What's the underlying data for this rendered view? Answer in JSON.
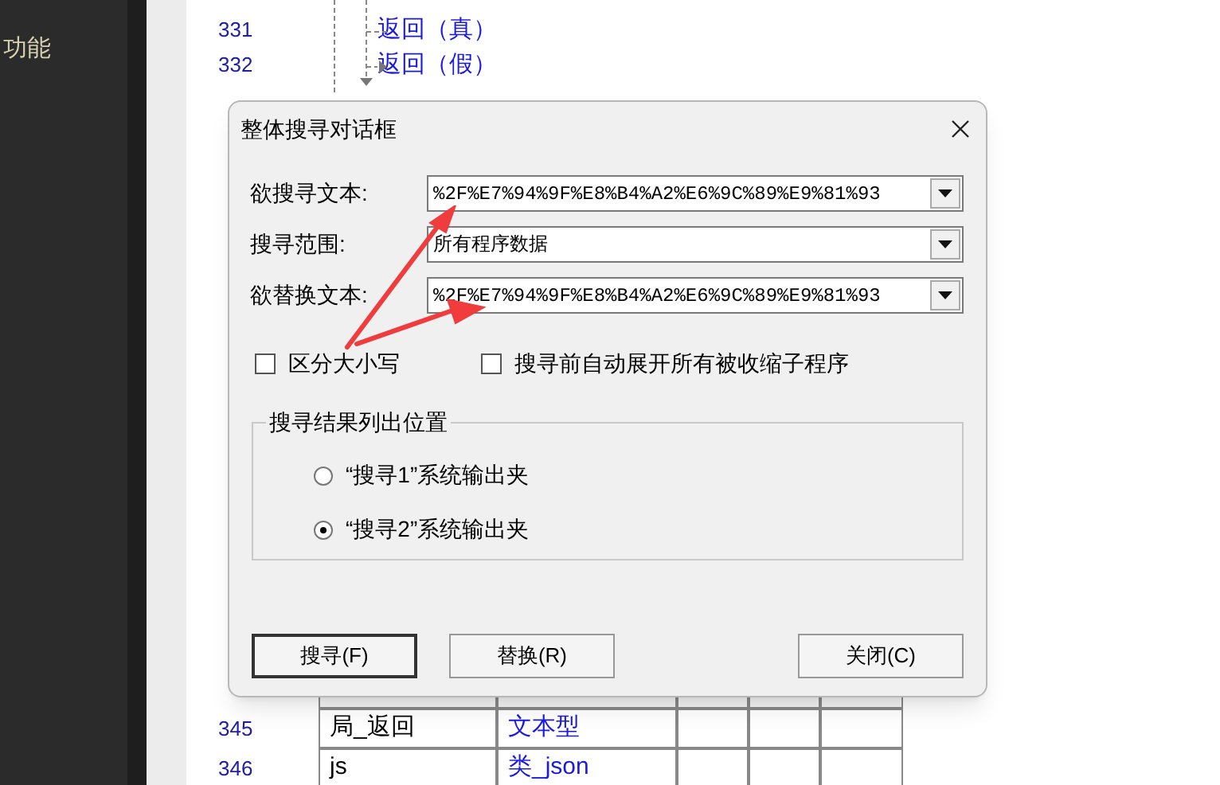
{
  "sidebar": {
    "item": "功能"
  },
  "editor": {
    "lines": [
      {
        "number": "331",
        "text": "返回（真）"
      },
      {
        "number": "332",
        "text": "返回（假）"
      }
    ],
    "table_rows": [
      {
        "number": "345",
        "cells": [
          "局_返回",
          "文本型",
          "",
          "",
          ""
        ]
      },
      {
        "number": "346",
        "cells": [
          "js",
          "类_json",
          "",
          "",
          ""
        ]
      }
    ]
  },
  "dialog": {
    "title": "整体搜寻对话框",
    "fields": [
      {
        "label": "欲搜寻文本:",
        "value": "%2F%E7%94%9F%E8%B4%A2%E6%9C%89%E9%81%93"
      },
      {
        "label": "搜寻范围:",
        "value": "所有程序数据"
      },
      {
        "label": "欲替换文本:",
        "value": "%2F%E7%94%9F%E8%B4%A2%E6%9C%89%E9%81%93"
      }
    ],
    "checkboxes": [
      {
        "label": "区分大小写",
        "checked": false
      },
      {
        "label": "搜寻前自动展开所有被收缩子程序",
        "checked": false
      }
    ],
    "group": {
      "title": "搜寻结果列出位置",
      "options": [
        {
          "label": "“搜寻1”系统输出夹",
          "selected": false
        },
        {
          "label": "“搜寻2”系统输出夹",
          "selected": true
        }
      ]
    },
    "buttons": [
      {
        "label": "搜寻(F)",
        "default": true
      },
      {
        "label": "替换(R)",
        "default": false
      },
      {
        "label": "关闭(C)",
        "default": false
      }
    ]
  }
}
